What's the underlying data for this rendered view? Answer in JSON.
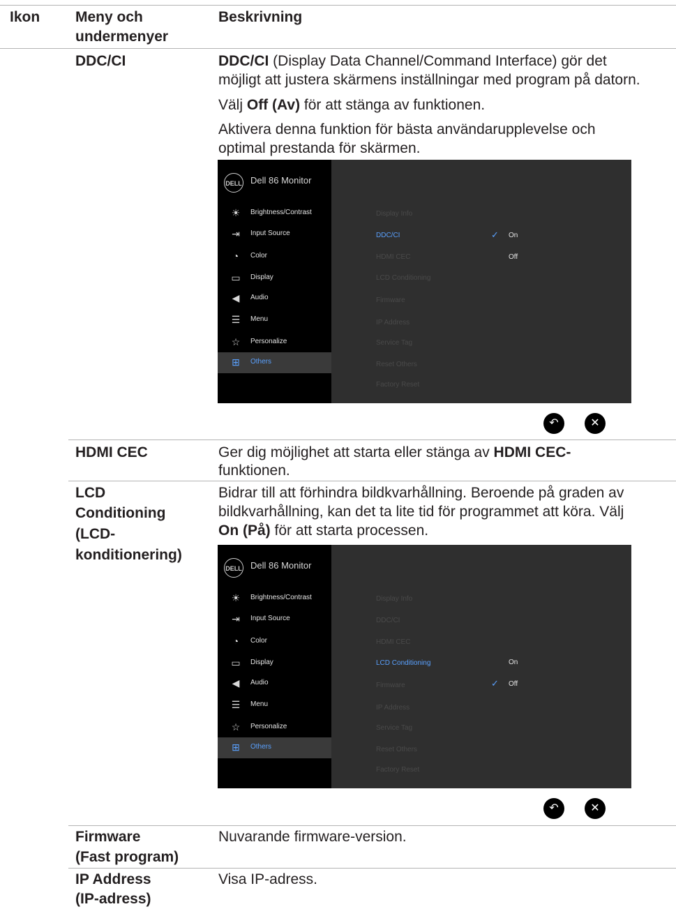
{
  "header": {
    "col_icon": "Ikon",
    "col_menu_1": "Meny och",
    "col_menu_2": "undermenyer",
    "col_desc": "Beskrivning"
  },
  "ddcci": {
    "name": "DDC/CI",
    "desc_bold": "DDC/CI",
    "desc_1_rest": " (Display Data Channel/Command Interface) gör det",
    "desc_2": "möjligt att justera skärmens inställningar med program på datorn.",
    "p2_pre": "Välj ",
    "p2_bold": "Off (Av)",
    "p2_post": " för att stänga av funktionen.",
    "p3_1": "Aktivera denna funktion för bästa användarupplevelse och",
    "p3_2": "optimal prestanda för skärmen."
  },
  "osd": {
    "logo": "DELL",
    "title": "Dell 86 Monitor",
    "menu": [
      "Brightness/Contrast",
      "Input Source",
      "Color",
      "Display",
      "Audio",
      "Menu",
      "Personalize",
      "Others"
    ],
    "submenu": [
      "Display Info",
      "DDC/CI",
      "HDMI CEC",
      "LCD Conditioning",
      "Firmware",
      "IP Address",
      "Service Tag",
      "Reset Others",
      "Factory Reset"
    ],
    "on": "On",
    "off": "Off",
    "check": "✓",
    "back": "↶",
    "close": "✕"
  },
  "hdmi": {
    "name": "HDMI CEC",
    "desc_1_pre": "Ger dig möjlighet att starta eller stänga av ",
    "desc_1_bold": "HDMI CEC-",
    "desc_2": "funktionen."
  },
  "lcd": {
    "name_1": "LCD",
    "name_2": "Conditioning",
    "name_3": "(LCD-",
    "name_4": "konditionering)",
    "desc_1": "Bidrar till att förhindra bildkvarhållning. Beroende på graden av",
    "desc_2": "bildkvarhållning, kan det ta lite tid för programmet att köra. Välj",
    "desc_3_bold": "On (På)",
    "desc_3_post": " för att starta processen."
  },
  "firmware": {
    "name_1": "Firmware",
    "name_2": "(Fast program)",
    "desc": "Nuvarande firmware-version."
  },
  "ip": {
    "name_1": "IP Address",
    "name_2": "(IP-adress)",
    "desc": "Visa IP-adress."
  }
}
